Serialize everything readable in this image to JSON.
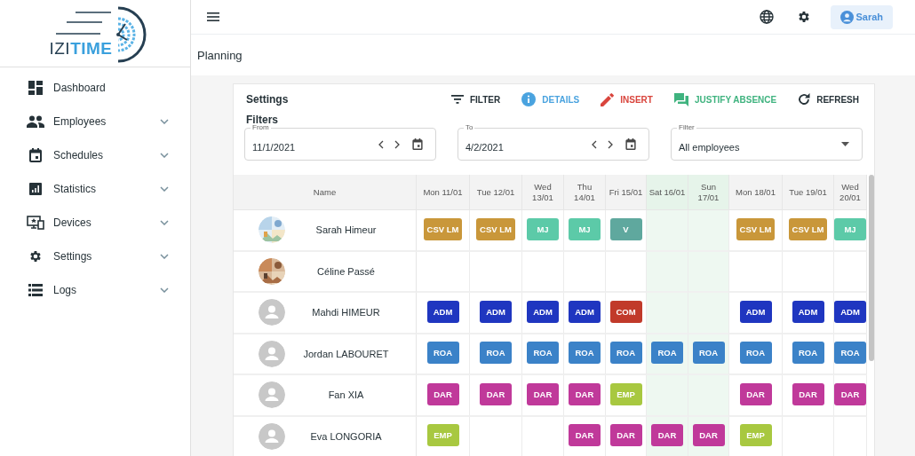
{
  "logo": [
    "IZI",
    "TIME"
  ],
  "sidebar": {
    "items": [
      {
        "label": "Dashboard"
      },
      {
        "label": "Employees",
        "expanded": false
      },
      {
        "label": "Schedules",
        "expanded": false
      },
      {
        "label": "Statistics",
        "expanded": false
      },
      {
        "label": "Devices",
        "expanded": false
      },
      {
        "label": "Settings",
        "expanded": false
      },
      {
        "label": "Logs",
        "expanded": false
      }
    ]
  },
  "topbar": {
    "user": "Sarah"
  },
  "page_title": "Planning",
  "card": {
    "title": "Settings",
    "actions": [
      {
        "label": "FILTER",
        "color": "#263238"
      },
      {
        "label": "DETAILS",
        "color": "#4aa3df"
      },
      {
        "label": "INSERT",
        "color": "#d9453d"
      },
      {
        "label": "JUSTIFY ABSENCE",
        "color": "#3fb37f"
      },
      {
        "label": "REFRESH",
        "color": "#263238"
      }
    ],
    "filters_title": "Filters",
    "fields": [
      {
        "kind": "date",
        "label": "From",
        "value": "11/1/2021"
      },
      {
        "kind": "date",
        "label": "To",
        "value": "4/2/2021"
      },
      {
        "kind": "select",
        "label": "Filter",
        "value": "All employees"
      }
    ]
  },
  "table": {
    "name_column": "Name",
    "columns": [
      {
        "label": "Mon 11/01",
        "weekend": false
      },
      {
        "label": "Tue 12/01",
        "weekend": false
      },
      {
        "label": "Wed 13/01",
        "weekend": false
      },
      {
        "label": "Thu 14/01",
        "weekend": false
      },
      {
        "label": "Fri 15/01",
        "weekend": false
      },
      {
        "label": "Sat 16/01",
        "weekend": true
      },
      {
        "label": "Sun 17/01",
        "weekend": true
      },
      {
        "label": "Mon 18/01",
        "weekend": false
      },
      {
        "label": "Tue 19/01",
        "weekend": false
      },
      {
        "label": "Wed 20/01",
        "weekend": false
      }
    ],
    "rows": [
      {
        "name": "Sarah Himeur",
        "photo": true,
        "cells": [
          {
            "code": "CSV LM",
            "color": "#c9973a"
          },
          {
            "code": "CSV LM",
            "color": "#c9973a"
          },
          {
            "code": "MJ",
            "color": "#5ccaa8"
          },
          {
            "code": "MJ",
            "color": "#5ccaa8"
          },
          {
            "code": "V",
            "color": "#5fa89e"
          },
          null,
          null,
          {
            "code": "CSV LM",
            "color": "#c9973a"
          },
          {
            "code": "CSV LM",
            "color": "#c9973a"
          },
          {
            "code": "MJ",
            "color": "#5ccaa8"
          }
        ]
      },
      {
        "name": "Céline Passé",
        "photo": true,
        "cells": [
          null,
          null,
          null,
          null,
          null,
          null,
          null,
          null,
          null,
          null
        ]
      },
      {
        "name": "Mahdi HIMEUR",
        "photo": false,
        "cells": [
          {
            "code": "ADM",
            "color": "#1f36c0"
          },
          {
            "code": "ADM",
            "color": "#1f36c0"
          },
          {
            "code": "ADM",
            "color": "#1f36c0"
          },
          {
            "code": "ADM",
            "color": "#1f36c0"
          },
          {
            "code": "COM",
            "color": "#c13a2a"
          },
          null,
          null,
          {
            "code": "ADM",
            "color": "#1f36c0"
          },
          {
            "code": "ADM",
            "color": "#1f36c0"
          },
          {
            "code": "ADM",
            "color": "#1f36c0"
          }
        ]
      },
      {
        "name": "Jordan LABOURET",
        "photo": false,
        "cells": [
          {
            "code": "ROA",
            "color": "#3b82c8"
          },
          {
            "code": "ROA",
            "color": "#3b82c8"
          },
          {
            "code": "ROA",
            "color": "#3b82c8"
          },
          {
            "code": "ROA",
            "color": "#3b82c8"
          },
          {
            "code": "ROA",
            "color": "#3b82c8"
          },
          {
            "code": "ROA",
            "color": "#3b82c8"
          },
          {
            "code": "ROA",
            "color": "#3b82c8"
          },
          {
            "code": "ROA",
            "color": "#3b82c8"
          },
          {
            "code": "ROA",
            "color": "#3b82c8"
          },
          {
            "code": "ROA",
            "color": "#3b82c8"
          }
        ]
      },
      {
        "name": "Fan XIA",
        "photo": false,
        "cells": [
          {
            "code": "DAR",
            "color": "#c0399a"
          },
          {
            "code": "DAR",
            "color": "#c0399a"
          },
          {
            "code": "DAR",
            "color": "#c0399a"
          },
          {
            "code": "DAR",
            "color": "#c0399a"
          },
          {
            "code": "EMP",
            "color": "#a8c840"
          },
          null,
          null,
          {
            "code": "DAR",
            "color": "#c0399a"
          },
          {
            "code": "DAR",
            "color": "#c0399a"
          },
          {
            "code": "DAR",
            "color": "#c0399a"
          }
        ]
      },
      {
        "name": "Eva LONGORIA",
        "photo": false,
        "cells": [
          {
            "code": "EMP",
            "color": "#a8c840"
          },
          null,
          null,
          {
            "code": "DAR",
            "color": "#c0399a"
          },
          {
            "code": "DAR",
            "color": "#c0399a"
          },
          {
            "code": "DAR",
            "color": "#c0399a"
          },
          {
            "code": "DAR",
            "color": "#c0399a"
          },
          {
            "code": "EMP",
            "color": "#a8c840"
          },
          null,
          null
        ]
      }
    ]
  }
}
